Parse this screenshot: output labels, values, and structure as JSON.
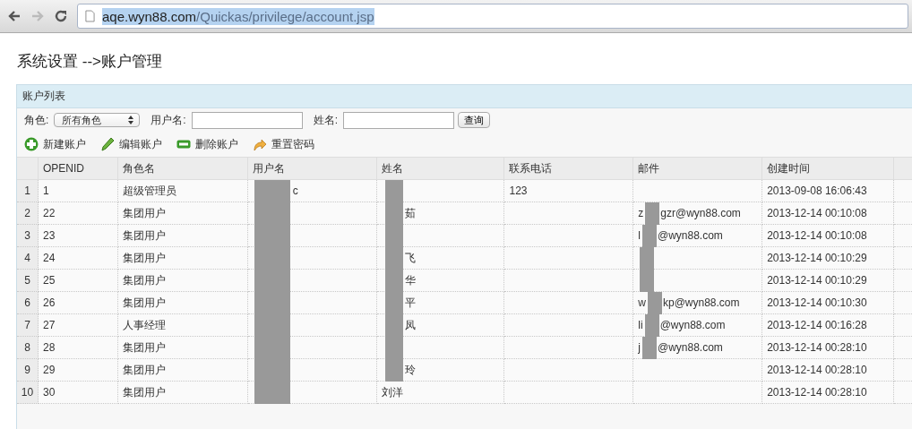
{
  "browser": {
    "back": {
      "disabled": false
    },
    "forward": {
      "disabled": true
    },
    "url_host": "aqe.wyn88.com",
    "url_path": "/Quickas/privilege/account.jsp",
    "url_selected": true
  },
  "page_title": "系统设置 -->账户管理",
  "panel": {
    "title": "账户列表",
    "filters": [
      {
        "label": "角色:",
        "kind": "select",
        "value": "所有角色"
      },
      {
        "label": "用户名:",
        "kind": "text"
      },
      {
        "label": "姓名:",
        "kind": "text"
      }
    ],
    "search_button": "查询",
    "actions": [
      {
        "label": "新建账户",
        "kind": "add"
      },
      {
        "label": "编辑账户",
        "kind": "edit"
      },
      {
        "label": "删除账户",
        "kind": "delete"
      },
      {
        "label": "重置密码",
        "kind": "reset"
      }
    ],
    "table": {
      "columns": [
        "OPENID",
        "角色名",
        "用户名",
        "姓名",
        "联系电话",
        "邮件",
        "创建时间"
      ],
      "rows": [
        {
          "index": "1",
          "openid": "1",
          "role": "超级管理员",
          "username": {
            "redacted": true,
            "after": "c"
          },
          "name": {
            "redacted": true
          },
          "phone": "123",
          "created": "2013-09-08 16:06:43"
        },
        {
          "index": "2",
          "openid": "22",
          "role": "集团用户",
          "username": {
            "redacted": true
          },
          "name": {
            "redacted": true,
            "after": "茹"
          },
          "email": {
            "redacted": true,
            "before": "z",
            "after": "gzr@wyn88.com"
          },
          "created": "2013-12-14 00:10:08"
        },
        {
          "index": "3",
          "openid": "23",
          "role": "集团用户",
          "username": {
            "redacted": true
          },
          "name": {
            "redacted": true
          },
          "email": {
            "redacted": true,
            "before": "l",
            "after": "@wyn88.com"
          },
          "created": "2013-12-14 00:10:08"
        },
        {
          "index": "4",
          "openid": "24",
          "role": "集团用户",
          "username": {
            "redacted": true
          },
          "name": {
            "redacted": true,
            "after": "飞"
          },
          "email": {
            "redacted": true
          },
          "created": "2013-12-14 00:10:29"
        },
        {
          "index": "5",
          "openid": "25",
          "role": "集团用户",
          "username": {
            "redacted": true
          },
          "name": {
            "redacted": true,
            "after": "华"
          },
          "email": {
            "redacted": true
          },
          "created": "2013-12-14 00:10:29"
        },
        {
          "index": "6",
          "openid": "26",
          "role": "集团用户",
          "username": {
            "redacted": true
          },
          "name": {
            "redacted": true,
            "after": "平"
          },
          "email": {
            "redacted": true,
            "before": "w",
            "after": "kp@wyn88.com"
          },
          "created": "2013-12-14 00:10:30"
        },
        {
          "index": "7",
          "openid": "27",
          "role": "人事经理",
          "username": {
            "redacted": true
          },
          "name": {
            "redacted": true,
            "after": "凤"
          },
          "email": {
            "redacted": true,
            "before": "li",
            "after": "@wyn88.com"
          },
          "created": "2013-12-14 00:16:28"
        },
        {
          "index": "8",
          "openid": "28",
          "role": "集团用户",
          "username": {
            "redacted": true
          },
          "name": {
            "redacted": true
          },
          "email": {
            "redacted": true,
            "before": "j",
            "after": "@wyn88.com"
          },
          "created": "2013-12-14 00:28:10"
        },
        {
          "index": "9",
          "openid": "29",
          "role": "集团用户",
          "username": {
            "redacted": true
          },
          "name": {
            "redacted": true,
            "after": "玲"
          },
          "created": "2013-12-14 00:28:10"
        },
        {
          "index": "10",
          "openid": "30",
          "role": "集团用户",
          "username": {
            "redacted": true
          },
          "name": {
            "before": "刘洋"
          },
          "created": "2013-12-14 00:28:10"
        }
      ]
    }
  }
}
